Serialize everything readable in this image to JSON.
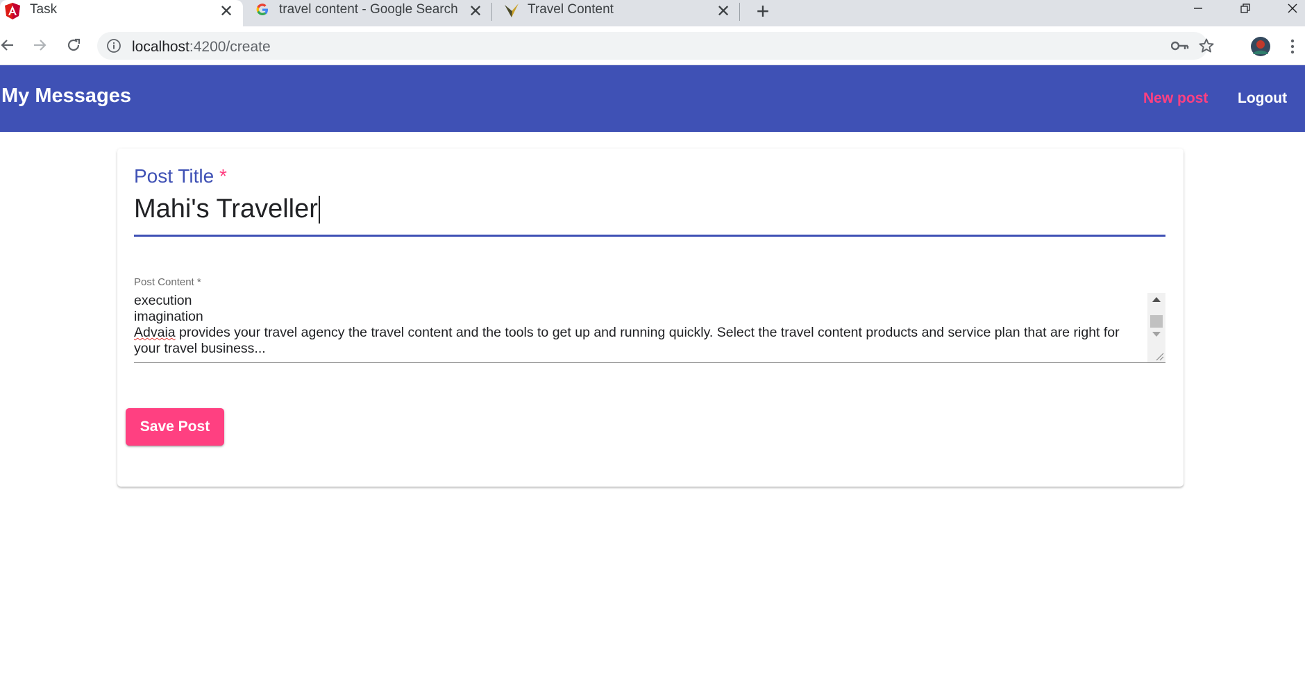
{
  "browser": {
    "tabs": [
      {
        "title": "Task",
        "icon": "angular-icon",
        "active": true
      },
      {
        "title": "travel content - Google Search",
        "icon": "google-icon",
        "active": false
      },
      {
        "title": "Travel Content",
        "icon": "travel-content-favicon",
        "active": false
      }
    ],
    "close_glyph": "✕",
    "new_tab_glyph": "+",
    "url_host": "localhost",
    "url_path": ":4200/create"
  },
  "app": {
    "brand": "My Messages",
    "nav": {
      "new_post": "New post",
      "logout": "Logout"
    },
    "colors": {
      "primary": "#3f51b5",
      "accent": "#ff4081"
    }
  },
  "form": {
    "title_label": "Post Title",
    "required_mark": "*",
    "title_value": "Mahi's Traveller",
    "content_label": "Post Content *",
    "content_lines": [
      "execution",
      "imagination",
      "provides your travel agency the travel content and the tools to get up and running quickly. Select the travel content products and service plan that are right for your travel business..."
    ],
    "content_misspelled_word": "Advaia",
    "save_label": "Save Post"
  }
}
